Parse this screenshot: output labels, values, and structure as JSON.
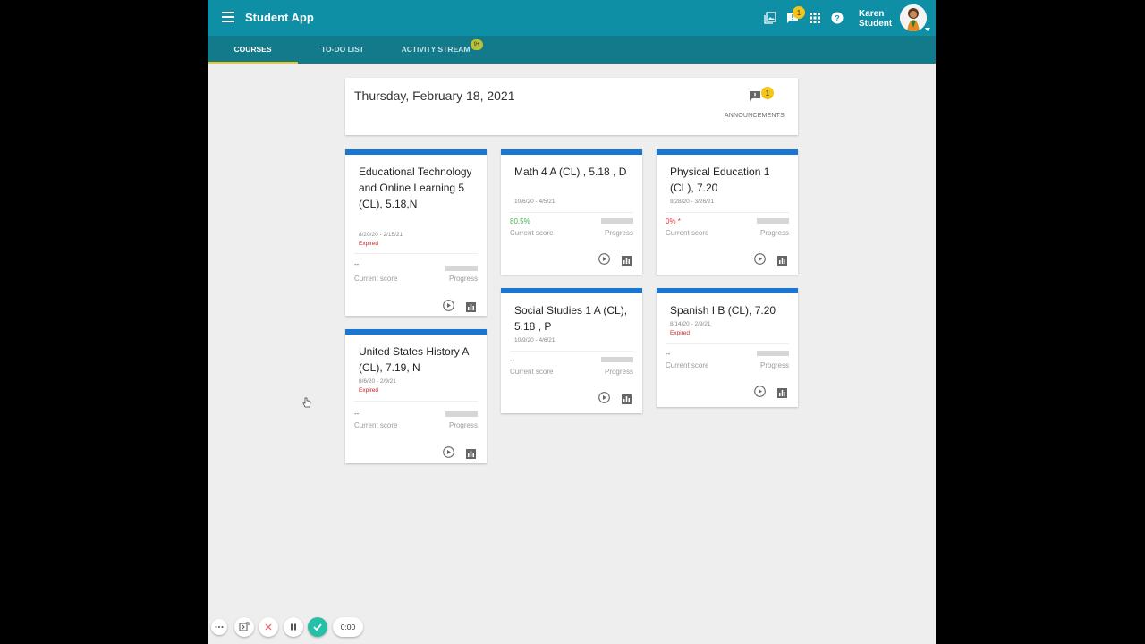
{
  "header": {
    "title": "Student App",
    "notification_count": "1",
    "user_name_line1": "Karen",
    "user_name_line2": "Student",
    "accent_color": "#0e8fa6",
    "icons": [
      "menu-icon",
      "gallery-icon",
      "notification-icon",
      "apps-grid-icon",
      "help-icon"
    ]
  },
  "tabs": [
    {
      "label": "COURSES",
      "active": true
    },
    {
      "label": "TO-DO LIST",
      "active": false
    },
    {
      "label": "ACTIVITY STREAM",
      "active": false,
      "badge": "9+"
    }
  ],
  "date_card": {
    "date": "Thursday, February 18, 2021",
    "announcement_count": "1",
    "announcements_label": "ANNOUNCEMENTS"
  },
  "courses": [
    {
      "title": "Educational Technology and Online Learning 5 (CL), 5.18,N",
      "dates": "8/20/20 - 2/15/21",
      "status": "Expired",
      "score": "--",
      "score_label": "Current score",
      "progress_label": "Progress"
    },
    {
      "title": "Math 4 A (CL) , 5.18 , D",
      "dates": "10/6/20 - 4/5/21",
      "status": "",
      "score": "80.5%",
      "score_color": "#4caf50",
      "score_label": "Current score",
      "progress_label": "Progress"
    },
    {
      "title": "Physical Education 1 (CL), 7.20",
      "dates": "9/28/20 - 3/26/21",
      "status": "",
      "score": "0% *",
      "score_color": "#e53935",
      "score_label": "Current score",
      "progress_label": "Progress"
    },
    {
      "title": "Social Studies 1 A (CL), 5.18 , P",
      "dates": "10/9/20 - 4/6/21",
      "status": "",
      "score": "--",
      "score_label": "Current score",
      "progress_label": "Progress"
    },
    {
      "title": "Spanish I B (CL), 7.20",
      "dates": "8/14/20 - 2/9/21",
      "status": "Expired",
      "score": "--",
      "score_label": "Current score",
      "progress_label": "Progress"
    },
    {
      "title": "United States History A (CL), 7.19, N",
      "dates": "8/6/20 - 2/9/21",
      "status": "Expired",
      "score": "--",
      "score_label": "Current score",
      "progress_label": "Progress"
    }
  ],
  "recorder": {
    "timer": "0:00",
    "accent_color": "#26bfa8"
  }
}
